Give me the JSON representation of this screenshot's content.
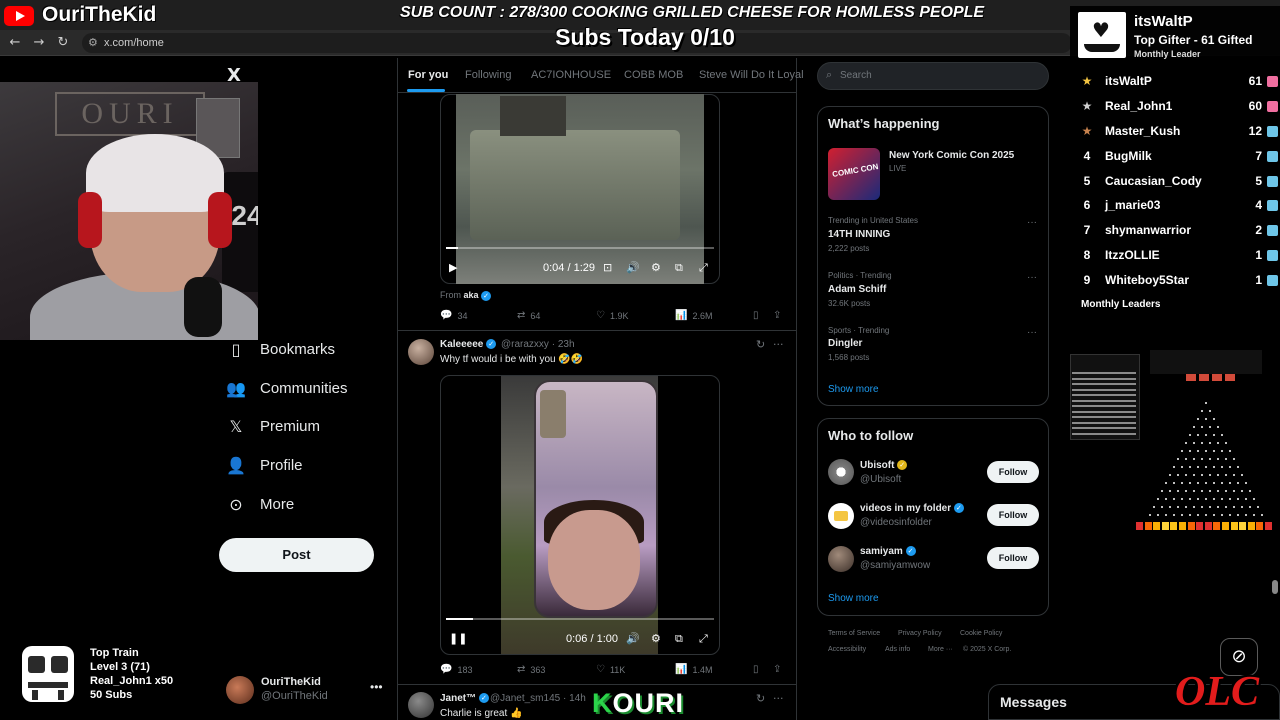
{
  "browser": {
    "url": "x.com/home",
    "back_icon": "back-arrow-icon",
    "forward_icon": "forward-arrow-icon",
    "reload_icon": "reload-icon"
  },
  "stream": {
    "channel_name": "OuriTheKid",
    "sub_count_banner": "SUB COUNT : 278/300 COOKING GRILLED CHEESE FOR HOMLESS PEOPLE",
    "subs_today": "Subs Today  0/10",
    "train": {
      "title": "Top Train",
      "level": "Level 3  (71)",
      "user": "Real_John1 x50",
      "subs": "50 Subs"
    },
    "kouri_logo": "OURI",
    "kouri_logo_k": "K",
    "olc_logo": "OLC"
  },
  "gifter": {
    "name": "itsWaltP",
    "title": "Top Gifter - 61 Gifted",
    "subtitle": "Monthly Leader",
    "footer": "Monthly Leaders",
    "entries": [
      {
        "rank": "",
        "medal": "gold",
        "name": "itsWaltP",
        "count": "61"
      },
      {
        "rank": "",
        "medal": "silver",
        "name": "Real_John1",
        "count": "60"
      },
      {
        "rank": "",
        "medal": "bronze",
        "name": "Master_Kush",
        "count": "12"
      },
      {
        "rank": "4",
        "name": "BugMilk",
        "count": "7"
      },
      {
        "rank": "5",
        "name": "Caucasian_Cody",
        "count": "5"
      },
      {
        "rank": "6",
        "name": "j_marie03",
        "count": "4"
      },
      {
        "rank": "7",
        "name": "shymanwarrior",
        "count": "2"
      },
      {
        "rank": "8",
        "name": "ItzzOLLIE",
        "count": "1"
      },
      {
        "rank": "9",
        "name": "Whiteboy5Star",
        "count": "1"
      }
    ]
  },
  "x": {
    "logo": "X",
    "nav": [
      {
        "label": "Bookmarks",
        "icon": "bookmark-icon",
        "glyph": "▯"
      },
      {
        "label": "Communities",
        "icon": "communities-icon",
        "glyph": "👥"
      },
      {
        "label": "Premium",
        "icon": "x-premium-icon",
        "glyph": "𝕏"
      },
      {
        "label": "Profile",
        "icon": "profile-icon",
        "glyph": "👤"
      },
      {
        "label": "More",
        "icon": "more-circle-icon",
        "glyph": "⊙"
      }
    ],
    "post_button": "Post",
    "account": {
      "name": "OuriTheKid",
      "handle": "@OuriTheKid"
    },
    "tabs": [
      "For you",
      "Following",
      "AC7IONHOUSE",
      "COBB MOB",
      "Steve Will Do It Loyal"
    ],
    "post1": {
      "video_time": "0:04 / 1:29",
      "video_progress": 0.045,
      "from_label": "From",
      "from_handle": "aka",
      "stats": {
        "replies": "34",
        "reposts": "64",
        "likes": "1.9K",
        "views": "2.6M"
      }
    },
    "post2": {
      "name": "Kaleeeee",
      "handle": "@rarazxxy · 23h",
      "text": "Why tf would i be with you 🤣🤣",
      "video_time": "0:06 / 1:00",
      "video_progress": 0.1,
      "stats": {
        "replies": "183",
        "reposts": "363",
        "likes": "11K",
        "views": "1.4M"
      }
    },
    "post3": {
      "name": "Janet™",
      "handle": "@Janet_sm145 · 14h",
      "text": "Charlie is great 👍"
    },
    "search_placeholder": "Search",
    "whats_happening": {
      "title": "What’s happening",
      "event_name": "New York Comic Con 2025",
      "event_status": "LIVE",
      "event_img_text": "COMIC CON",
      "trends": [
        {
          "context": "Trending in United States",
          "name": "14TH INNING",
          "posts": "2,222 posts"
        },
        {
          "context": "Politics · Trending",
          "name": "Adam Schiff",
          "posts": "32.6K posts"
        },
        {
          "context": "Sports · Trending",
          "name": "Dingler",
          "posts": "1,568 posts"
        }
      ],
      "show_more": "Show more"
    },
    "who_to_follow": {
      "title": "Who to follow",
      "accounts": [
        {
          "name": "Ubisoft",
          "handle": "@Ubisoft",
          "badge": "gold",
          "button": "Follow"
        },
        {
          "name": "videos in my folder",
          "handle": "@videosinfolder",
          "badge": "blue",
          "button": "Follow"
        },
        {
          "name": "samiyam",
          "handle": "@samiyamwow",
          "badge": "blue",
          "button": "Follow"
        }
      ],
      "show_more": "Show more"
    },
    "footer_links": [
      "Terms of Service",
      "Privacy Policy",
      "Cookie Policy",
      "Accessibility",
      "Ads info",
      "More ···",
      "© 2025 X Corp."
    ],
    "messages": "Messages"
  }
}
